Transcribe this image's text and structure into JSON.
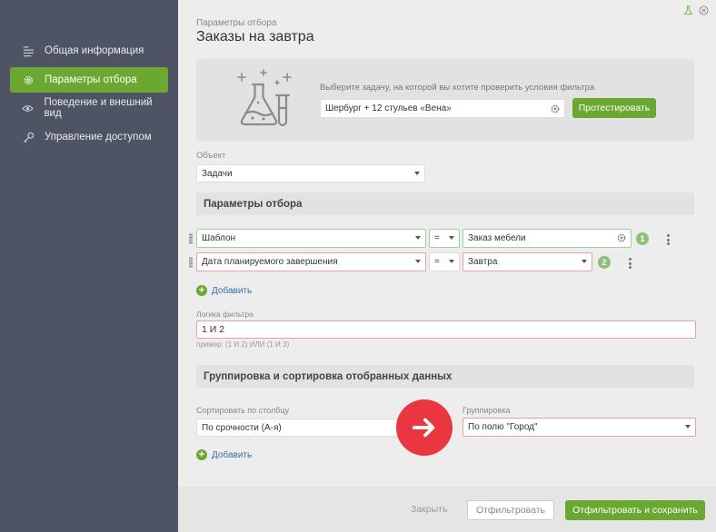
{
  "sidebar": {
    "items": [
      {
        "label": "Общая информация",
        "icon": "list-lines-icon",
        "active": false
      },
      {
        "label": "Параметры отбора",
        "icon": "gear-icon",
        "active": true
      },
      {
        "label": "Поведение и внешний вид",
        "icon": "eye-icon",
        "active": false
      },
      {
        "label": "Управление доступом",
        "icon": "key-icon",
        "active": false
      }
    ]
  },
  "header": {
    "breadcrumb": "Параметры отбора",
    "title": "Заказы на завтра"
  },
  "test_panel": {
    "hint": "Выберите задачу, на которой вы хотите проверить условия фильтра",
    "task_value": "Шербург + 12 стульев «Вена»",
    "test_button": "Протестировать"
  },
  "object": {
    "label": "Объект",
    "value": "Задачи"
  },
  "filter_section": {
    "title": "Параметры отбора",
    "conditions": [
      {
        "field": "Шаблон",
        "operator": "=",
        "value": "Заказ мебели",
        "number": "1"
      },
      {
        "field": "Дата планируемого завершения",
        "operator": "=",
        "value": "Завтра",
        "number": "2"
      }
    ],
    "add_label": "Добавить"
  },
  "filter_logic": {
    "label": "Логика фильтра",
    "value": "1 И 2",
    "hint": "пример: (1 И 2) ИЛИ (1 И 3)"
  },
  "grouping_section": {
    "title": "Группировка и сортировка отобранных данных",
    "sort_label": "Сортировать по столбцу",
    "sort_value": "По срочности (А-я)",
    "group_label": "Группировка",
    "group_value": "По полю \"Город\"",
    "add_label": "Добавить"
  },
  "footer": {
    "close": "Закрыть",
    "filter": "Отфильтровать",
    "filter_save": "Отфильтровать и сохранить"
  },
  "colors": {
    "accent_green": "#6aa832",
    "sidebar_bg": "#4e5464",
    "highlight_red": "#ea3640"
  }
}
